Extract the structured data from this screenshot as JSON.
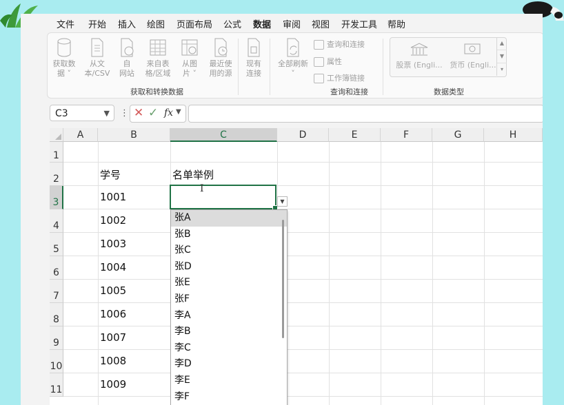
{
  "menu": [
    "文件",
    "开始",
    "插入",
    "绘图",
    "页面布局",
    "公式",
    "数据",
    "审阅",
    "视图",
    "开发工具",
    "帮助"
  ],
  "active_tab": "数据",
  "ribbon": {
    "get_transform": {
      "buttons": [
        {
          "label": "获取数\n据 ˅",
          "icon": "database-icon"
        },
        {
          "label": "从文\n本/CSV",
          "icon": "text-file-icon"
        },
        {
          "label": "自\n网站",
          "icon": "web-icon"
        },
        {
          "label": "来自表\n格/区域",
          "icon": "table-icon"
        },
        {
          "label": "从图\n片 ˅",
          "icon": "picture-icon"
        },
        {
          "label": "最近使\n用的源",
          "icon": "recent-icon"
        },
        {
          "label": "现有\n连接",
          "icon": "connection-icon"
        }
      ],
      "group_label": "获取和转换数据"
    },
    "queries": {
      "refresh_label": "全部刷新\n˅",
      "items": [
        "查询和连接",
        "属性",
        "工作簿链接"
      ],
      "group_label": "查询和连接"
    },
    "data_types": {
      "items": [
        "股票 (Engli...",
        "货币 (Engli..."
      ],
      "group_label": "数据类型"
    }
  },
  "formula_bar": {
    "name_box": "C3",
    "fx": "fx",
    "content": ""
  },
  "columns": [
    "A",
    "B",
    "C",
    "D",
    "E",
    "F",
    "G",
    "H"
  ],
  "rows": [
    "1",
    "2",
    "3",
    "4",
    "5",
    "6",
    "7",
    "8",
    "9",
    "10",
    "11"
  ],
  "cells": {
    "B2": "学号",
    "C2": "名单举例",
    "B": [
      "1001",
      "1002",
      "1003",
      "1004",
      "1005",
      "1006",
      "1007",
      "1008",
      "1009"
    ]
  },
  "dropdown": {
    "items": [
      "张A",
      "张B",
      "张C",
      "张D",
      "张E",
      "张F",
      "李A",
      "李B",
      "李C",
      "李D",
      "李E",
      "李F"
    ],
    "highlighted": 0
  },
  "colors": {
    "accent": "#1f7245",
    "background": "#a9ecf0"
  }
}
